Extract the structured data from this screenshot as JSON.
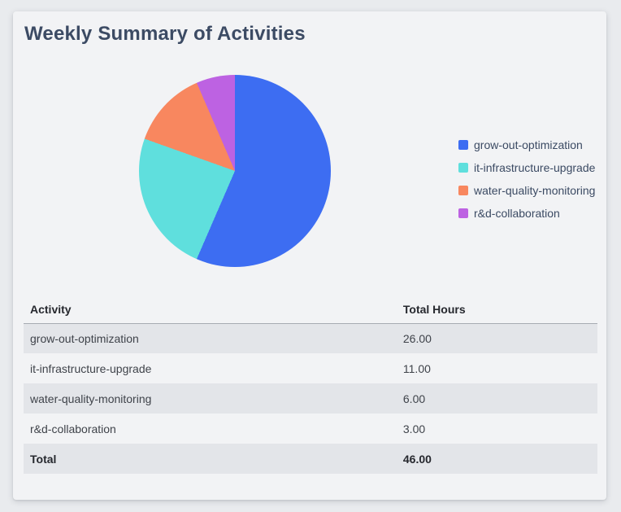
{
  "card": {
    "title": "Weekly Summary of Activities"
  },
  "chart_data": {
    "type": "pie",
    "labels": [
      "grow-out-optimization",
      "it-infrastructure-upgrade",
      "water-quality-monitoring",
      "r&d-collaboration"
    ],
    "values": [
      26,
      11,
      6,
      3
    ],
    "colors": [
      "#3D6DF2",
      "#5FDFDD",
      "#F8875F",
      "#BD62E2"
    ],
    "total": 46,
    "start_angle": "top",
    "direction": "clockwise",
    "legend_position": "right"
  },
  "table": {
    "headers": [
      "Activity",
      "Total Hours"
    ],
    "rows": [
      {
        "activity": "grow-out-optimization",
        "hours": "26.00"
      },
      {
        "activity": "it-infrastructure-upgrade",
        "hours": "11.00"
      },
      {
        "activity": "water-quality-monitoring",
        "hours": "6.00"
      },
      {
        "activity": "r&d-collaboration",
        "hours": "3.00"
      }
    ],
    "total_row": {
      "label": "Total",
      "hours": "46.00"
    }
  }
}
